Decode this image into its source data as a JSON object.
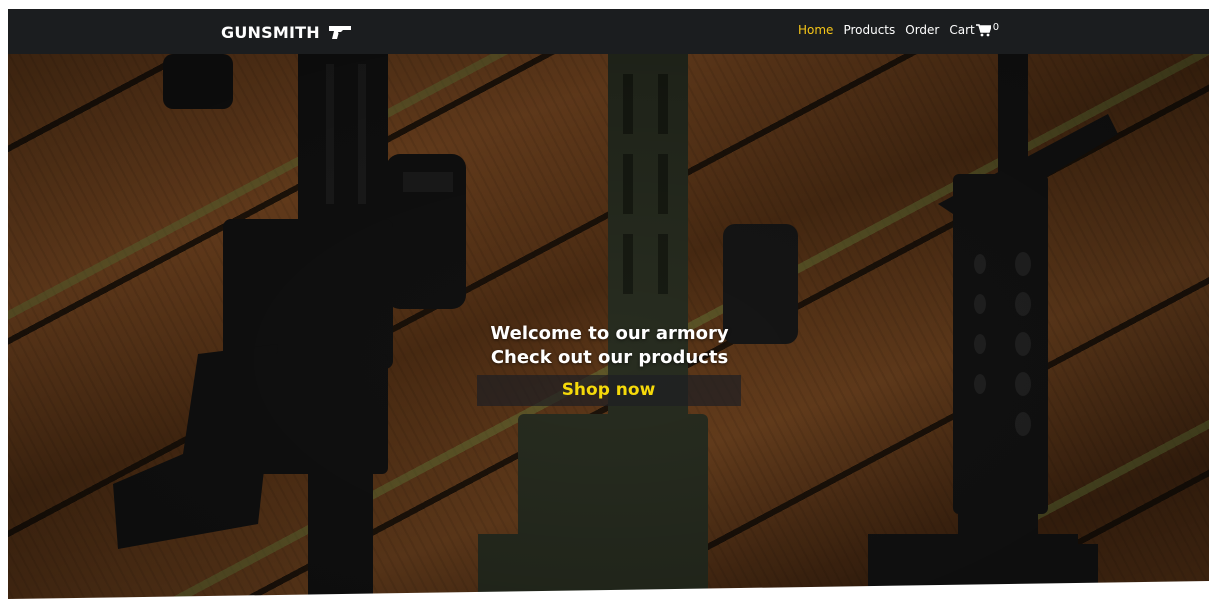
{
  "brand": {
    "name": "GUNSMITH",
    "icon": "pistol-icon"
  },
  "nav": {
    "items": [
      {
        "label": "Home",
        "active": true
      },
      {
        "label": "Products",
        "active": false
      },
      {
        "label": "Order",
        "active": false
      },
      {
        "label": "Cart",
        "active": false
      }
    ],
    "cart_icon": "shopping-cart-icon",
    "cart_count": "0"
  },
  "hero": {
    "line1": "Welcome to our armory",
    "line2": "Check out our products",
    "cta_label": "Shop now"
  },
  "colors": {
    "navbar_bg": "#1b1d1f",
    "accent_yellow": "#f5c518",
    "cta_text": "#f5d90a",
    "text_white": "#ffffff"
  }
}
